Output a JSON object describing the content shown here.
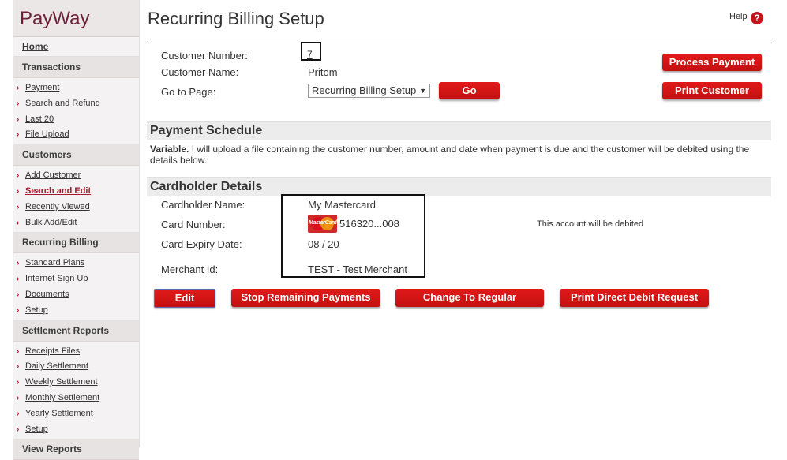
{
  "sidebar": {
    "brand": "PayWay",
    "home": "Home",
    "sections": [
      {
        "title": "Transactions",
        "items": [
          {
            "label": "Payment"
          },
          {
            "label": "Search and Refund"
          },
          {
            "label": "Last 20"
          },
          {
            "label": "File Upload"
          }
        ]
      },
      {
        "title": "Customers",
        "items": [
          {
            "label": "Add Customer"
          },
          {
            "label": "Search and Edit",
            "active": true
          },
          {
            "label": "Recently Viewed"
          },
          {
            "label": "Bulk Add/Edit"
          }
        ]
      },
      {
        "title": "Recurring Billing",
        "items": [
          {
            "label": "Standard Plans"
          },
          {
            "label": "Internet Sign Up"
          },
          {
            "label": "Documents"
          },
          {
            "label": "Setup"
          }
        ]
      },
      {
        "title": "Settlement Reports",
        "items": [
          {
            "label": "Receipts Files"
          },
          {
            "label": "Daily Settlement"
          },
          {
            "label": "Weekly Settlement"
          },
          {
            "label": "Monthly Settlement"
          },
          {
            "label": "Yearly Settlement"
          },
          {
            "label": "Setup"
          }
        ]
      },
      {
        "title": "View Reports",
        "items": []
      }
    ]
  },
  "header": {
    "title": "Recurring Billing Setup",
    "help": "Help",
    "help_icon": "?"
  },
  "customer": {
    "number_label": "Customer Number:",
    "number": "7",
    "name_label": "Customer Name:",
    "name": "Pritom",
    "goto_label": "Go to Page:",
    "goto_selected": "Recurring Billing Setup",
    "go_button": "Go",
    "process_payment": "Process Payment",
    "print_customer": "Print Customer"
  },
  "payment_schedule": {
    "title": "Payment Schedule",
    "type": "Variable.",
    "text": " I will upload a file containing the customer number, amount and date when payment is due and the customer will be debited using the details below."
  },
  "cardholder": {
    "title": "Cardholder Details",
    "name_label": "Cardholder Name:",
    "name": "My Mastercard",
    "card_label": "Card Number:",
    "card_number": "516320...008",
    "card_brand_icon": "mastercard-icon",
    "card_brand_text": "MasterCard",
    "expiry_label": "Card Expiry Date:",
    "expiry": "08 / 20",
    "merchant_label": "Merchant Id:",
    "merchant": "TEST - Test Merchant",
    "debit_note": "This account will be debited"
  },
  "actions": {
    "edit": "Edit",
    "stop": "Stop Remaining Payments",
    "change": "Change To Regular",
    "print_dd": "Print Direct Debit Request"
  },
  "colors": {
    "brand": "#6b1f3a",
    "button_red": "#cc1111",
    "active_link": "#a6192e"
  }
}
